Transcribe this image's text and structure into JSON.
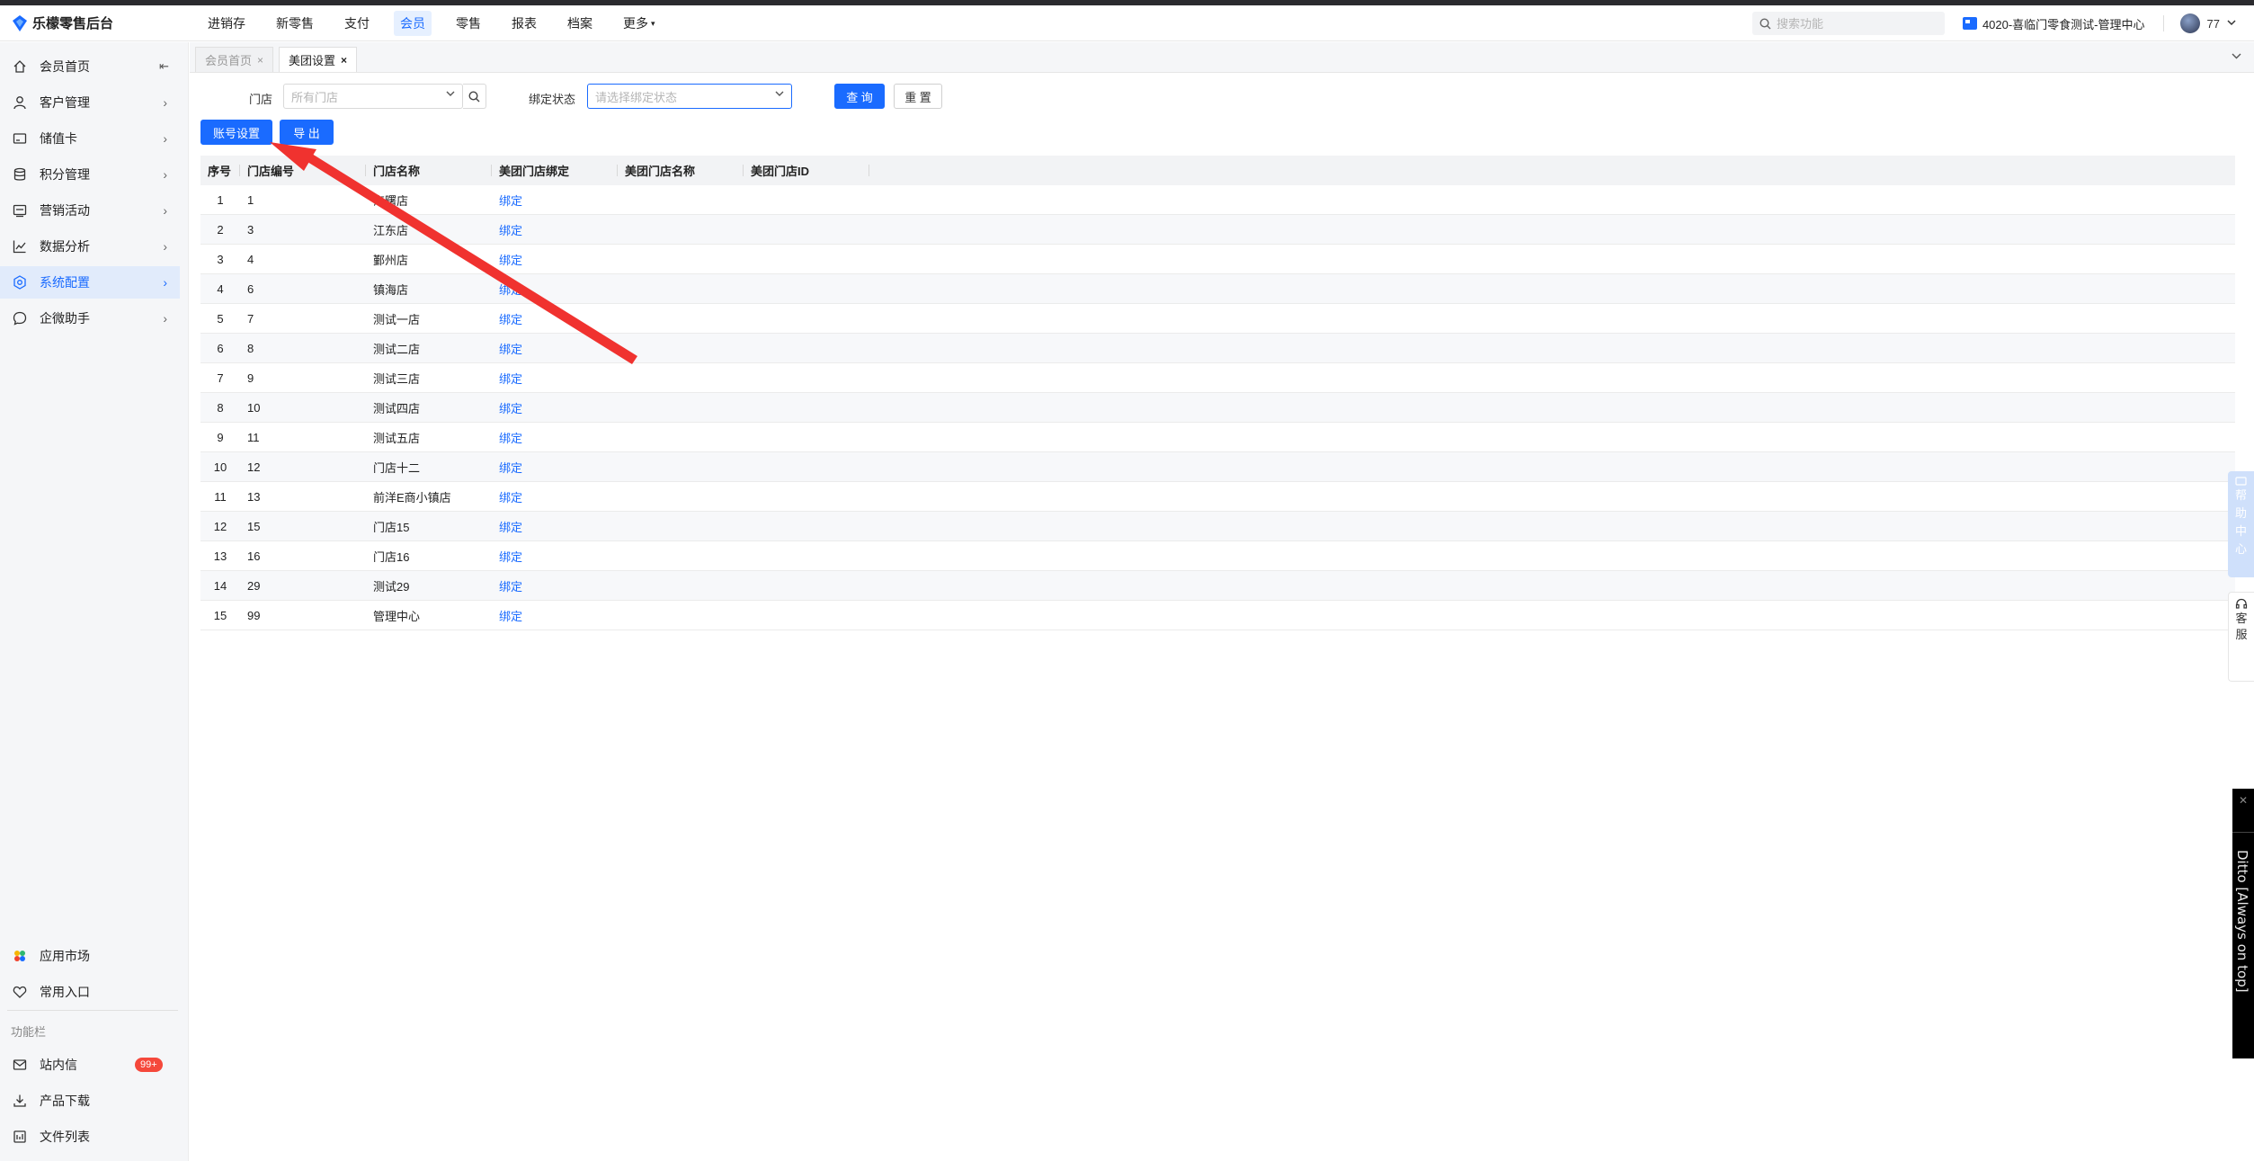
{
  "app": {
    "title": "乐檬零售后台"
  },
  "topnav": [
    {
      "label": "进销存",
      "active": false
    },
    {
      "label": "新零售",
      "active": false
    },
    {
      "label": "支付",
      "active": false
    },
    {
      "label": "会员",
      "active": true
    },
    {
      "label": "零售",
      "active": false
    },
    {
      "label": "报表",
      "active": false
    },
    {
      "label": "档案",
      "active": false
    },
    {
      "label": "更多",
      "active": false,
      "has_dropdown": true
    }
  ],
  "header": {
    "search_placeholder": "搜索功能",
    "store": "4020-喜临门零食测试-管理中心",
    "user": "77"
  },
  "sidebar": {
    "items": [
      {
        "label": "会员首页",
        "icon": "home-icon"
      },
      {
        "label": "客户管理",
        "icon": "user-icon"
      },
      {
        "label": "储值卡",
        "icon": "card-icon"
      },
      {
        "label": "积分管理",
        "icon": "database-icon"
      },
      {
        "label": "营销活动",
        "icon": "campaign-icon"
      },
      {
        "label": "数据分析",
        "icon": "chart-icon"
      },
      {
        "label": "系统配置",
        "icon": "settings-icon",
        "active": true
      },
      {
        "label": "企微助手",
        "icon": "chat-icon"
      }
    ],
    "bottom": [
      {
        "label": "应用市场",
        "icon": "app-market-icon"
      },
      {
        "label": "常用入口",
        "icon": "heart-icon"
      }
    ],
    "group_label": "功能栏",
    "tools": [
      {
        "label": "站内信",
        "icon": "mail-icon",
        "badge": "99+"
      },
      {
        "label": "产品下载",
        "icon": "download-icon"
      },
      {
        "label": "文件列表",
        "icon": "file-list-icon"
      }
    ]
  },
  "tabs": [
    {
      "label": "会员首页",
      "active": false
    },
    {
      "label": "美团设置",
      "active": true
    }
  ],
  "filters": {
    "store_label": "门店",
    "store_placeholder": "所有门店",
    "bind_label": "绑定状态",
    "bind_placeholder": "请选择绑定状态",
    "query_button": "查 询",
    "reset_button": "重 置"
  },
  "actions": {
    "account_settings": "账号设置",
    "export": "导 出"
  },
  "table": {
    "columns": [
      "序号",
      "门店编号",
      "门店名称",
      "美团门店绑定",
      "美团门店名称",
      "美团门店ID"
    ],
    "rows": [
      {
        "idx": "1",
        "code": "1",
        "name": "海曙店",
        "action": "绑定"
      },
      {
        "idx": "2",
        "code": "3",
        "name": "江东店",
        "action": "绑定"
      },
      {
        "idx": "3",
        "code": "4",
        "name": "鄞州店",
        "action": "绑定"
      },
      {
        "idx": "4",
        "code": "6",
        "name": "镇海店",
        "action": "绑定"
      },
      {
        "idx": "5",
        "code": "7",
        "name": "测试一店",
        "action": "绑定"
      },
      {
        "idx": "6",
        "code": "8",
        "name": "测试二店",
        "action": "绑定"
      },
      {
        "idx": "7",
        "code": "9",
        "name": "测试三店",
        "action": "绑定"
      },
      {
        "idx": "8",
        "code": "10",
        "name": "测试四店",
        "action": "绑定"
      },
      {
        "idx": "9",
        "code": "11",
        "name": "测试五店",
        "action": "绑定"
      },
      {
        "idx": "10",
        "code": "12",
        "name": "门店十二",
        "action": "绑定"
      },
      {
        "idx": "11",
        "code": "13",
        "name": "前洋E商小镇店",
        "action": "绑定"
      },
      {
        "idx": "12",
        "code": "15",
        "name": "门店15",
        "action": "绑定"
      },
      {
        "idx": "13",
        "code": "16",
        "name": "门店16",
        "action": "绑定"
      },
      {
        "idx": "14",
        "code": "29",
        "name": "测试29",
        "action": "绑定"
      },
      {
        "idx": "15",
        "code": "99",
        "name": "管理中心",
        "action": "绑定"
      }
    ]
  },
  "right_widgets": {
    "help": [
      "帮",
      "助",
      "中",
      "心"
    ],
    "customer_service": [
      "客",
      "服"
    ],
    "ditto": "Ditto [Always on top]"
  },
  "colors": {
    "primary": "#1a6bff",
    "annotation_arrow": "#f0322f",
    "badge": "#f5483b"
  }
}
